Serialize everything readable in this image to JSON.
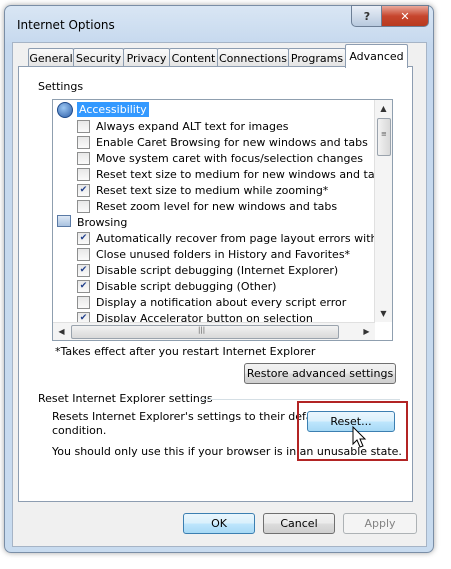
{
  "window": {
    "title": "Internet Options",
    "help_label": "?",
    "close_label": "✕"
  },
  "tabs": [
    {
      "label": "General"
    },
    {
      "label": "Security"
    },
    {
      "label": "Privacy"
    },
    {
      "label": "Content"
    },
    {
      "label": "Connections"
    },
    {
      "label": "Programs"
    },
    {
      "label": "Advanced"
    }
  ],
  "settings": {
    "group_label": "Settings",
    "categories": [
      {
        "label": "Accessibility",
        "icon": "accessibility-icon",
        "selected": true
      },
      {
        "label": "Browsing",
        "icon": "browsing-icon",
        "selected": false
      }
    ],
    "items": [
      {
        "label": "Always expand ALT text for images",
        "checked": false
      },
      {
        "label": "Enable Caret Browsing for new windows and tabs",
        "checked": false
      },
      {
        "label": "Move system caret with focus/selection changes",
        "checked": false
      },
      {
        "label": "Reset text size to medium for new windows and tabs",
        "checked": false
      },
      {
        "label": "Reset text size to medium while zooming*",
        "checked": true
      },
      {
        "label": "Reset zoom level for new windows and tabs",
        "checked": false
      },
      {
        "label": "Automatically recover from page layout errors with Compa",
        "checked": true
      },
      {
        "label": "Close unused folders in History and Favorites*",
        "checked": false
      },
      {
        "label": "Disable script debugging (Internet Explorer)",
        "checked": true
      },
      {
        "label": "Disable script debugging (Other)",
        "checked": true
      },
      {
        "label": "Display a notification about every script error",
        "checked": false
      },
      {
        "label": "Display Accelerator button on selection",
        "checked": true
      }
    ],
    "note": "*Takes effect after you restart Internet Explorer",
    "restore_label": "Restore advanced settings"
  },
  "reset": {
    "group_label": "Reset Internet Explorer settings",
    "desc_line1": "Resets Internet Explorer's settings to their default",
    "desc_line2": "condition.",
    "warning": "You should only use this if your browser is in an unusable state.",
    "button_label": "Reset..."
  },
  "footer": {
    "ok_label": "OK",
    "cancel_label": "Cancel",
    "apply_label": "Apply"
  },
  "colors": {
    "selection": "#3399ff",
    "highlight_box": "#b22424"
  }
}
